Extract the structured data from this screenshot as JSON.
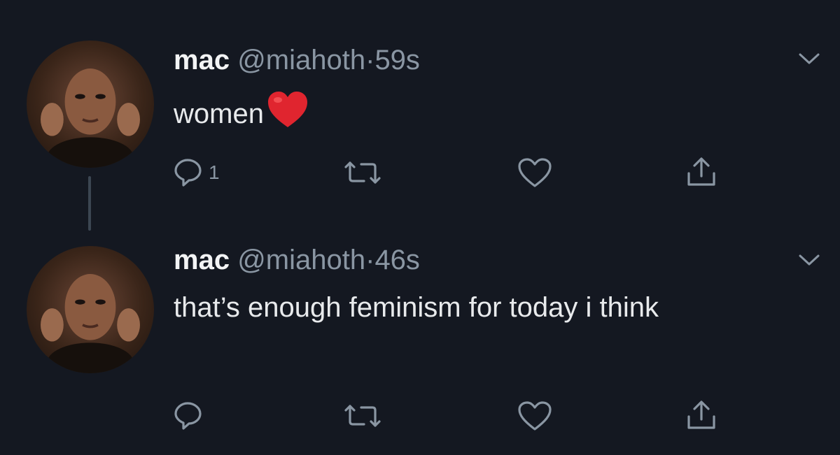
{
  "tweets": [
    {
      "name": "mac",
      "handle": "@miahoth",
      "separator": "·",
      "time": "59s",
      "text": "women",
      "emoji": "red-heart",
      "reply_count": "1"
    },
    {
      "name": "mac",
      "handle": "@miahoth",
      "separator": "·",
      "time": "46s",
      "text": "that’s enough feminism for today i think",
      "reply_count": ""
    }
  ],
  "colors": {
    "background": "#141821",
    "icon": "#8a96a3",
    "heart_emoji": "#e0252f"
  },
  "icons": [
    "chevron-down-icon",
    "reply-icon",
    "retweet-icon",
    "like-icon",
    "share-icon"
  ]
}
